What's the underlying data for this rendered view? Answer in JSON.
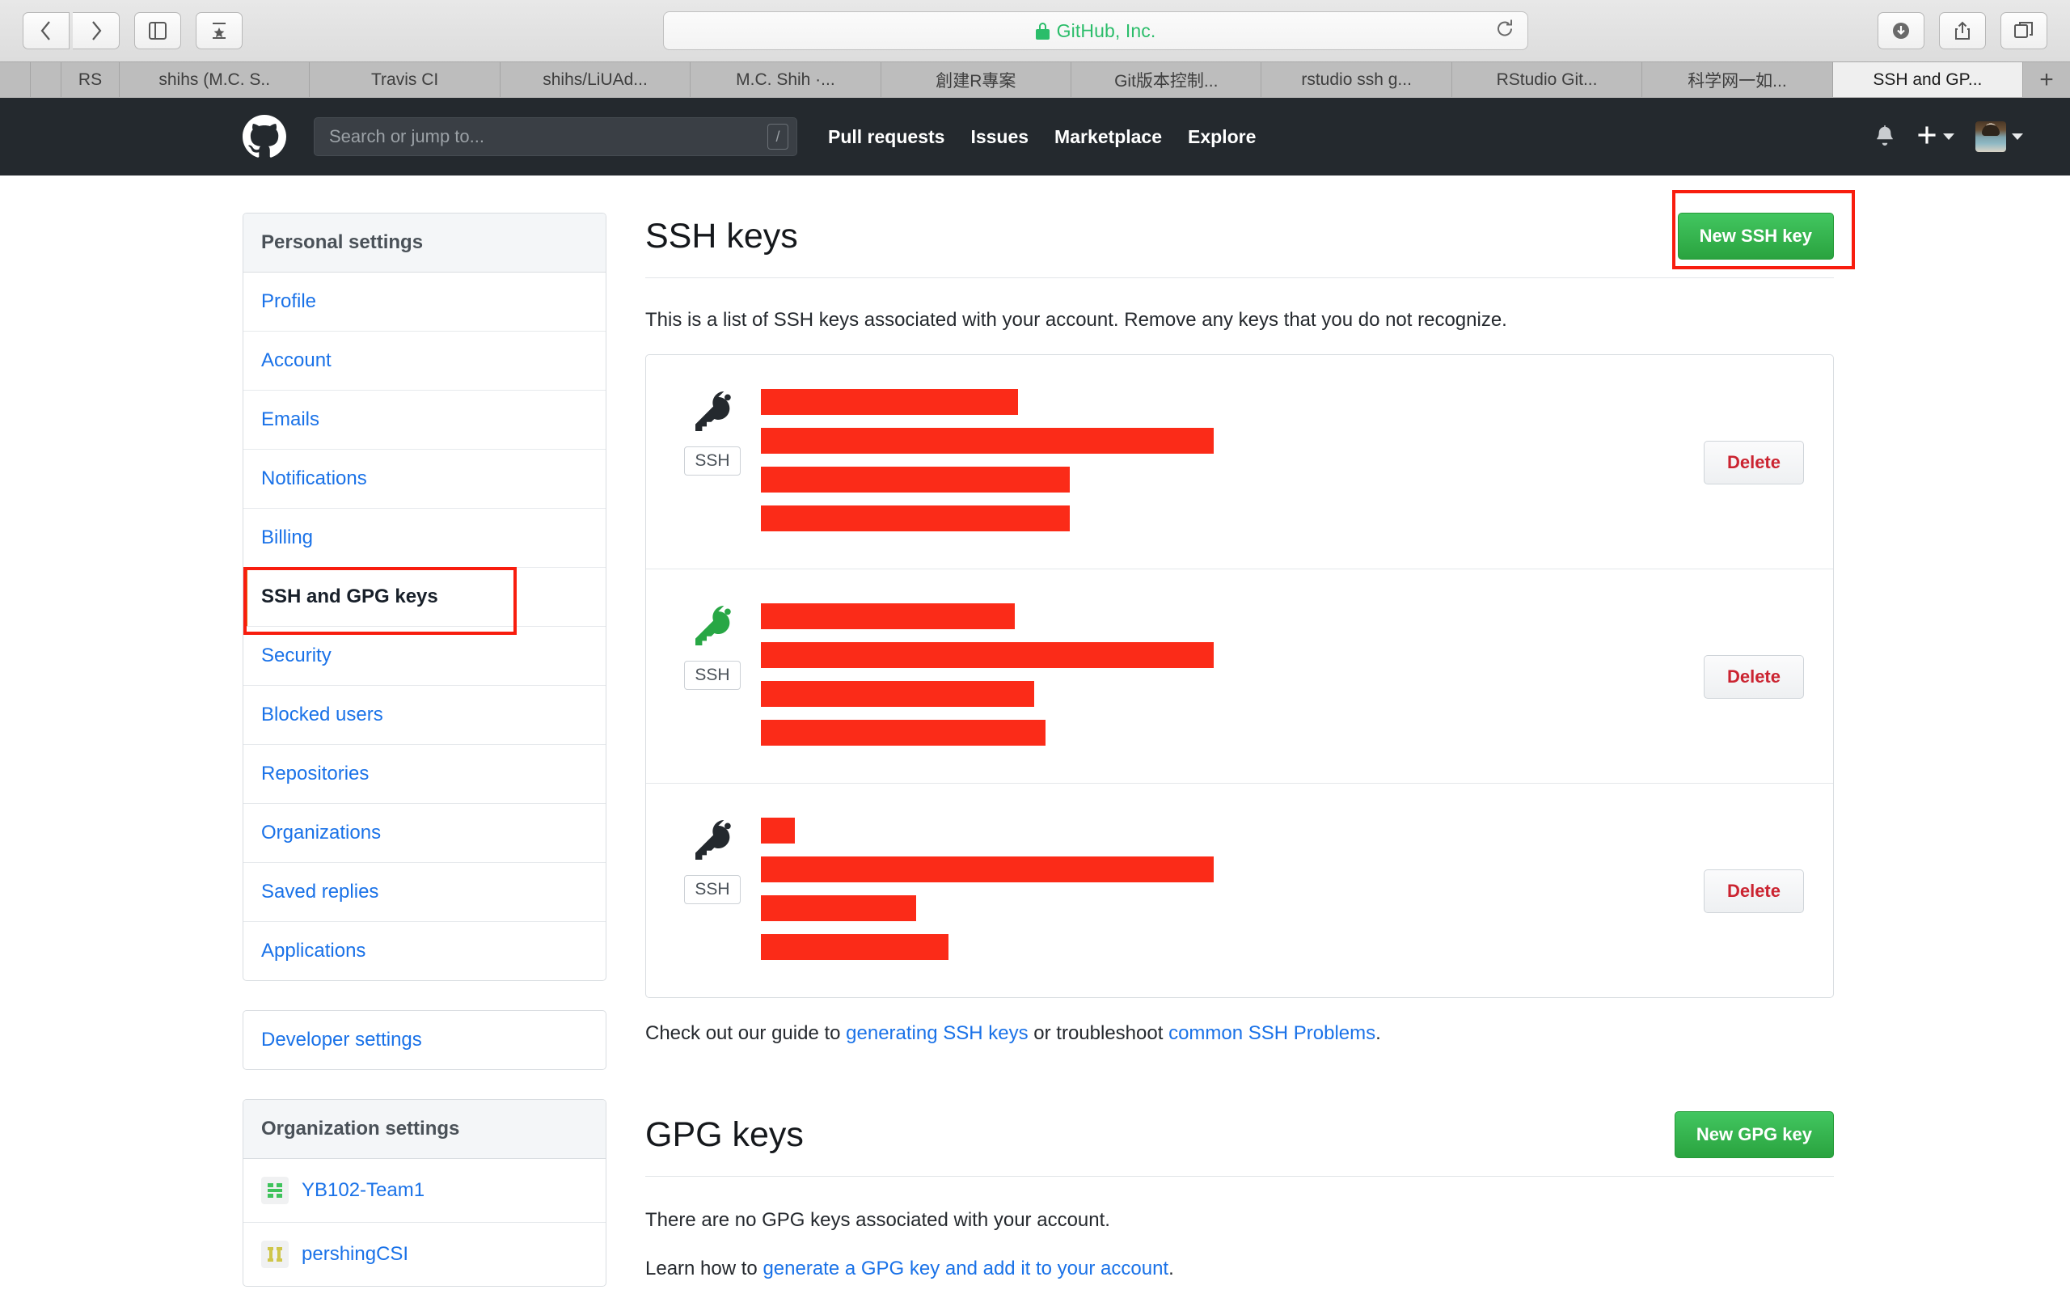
{
  "browser": {
    "address": {
      "site_name": "GitHub, Inc.",
      "secure_icon": "lock-icon",
      "reload_icon": "reload-icon"
    },
    "nav_back_icon": "chevron-left-icon",
    "nav_forward_icon": "chevron-right-icon",
    "sidebar_toggle_icon": "sidebar-icon",
    "bookmarks_icon": "bookmarks-icon",
    "downloads_icon": "downloads-icon",
    "share_icon": "share-icon",
    "tabs_overview_icon": "tabs-overview-icon",
    "new_tab_label": "+",
    "tabs": [
      {
        "label": "",
        "size": "tiny"
      },
      {
        "label": "",
        "size": "tiny"
      },
      {
        "label": "RS",
        "size": "narrow"
      },
      {
        "label": "shihs (M.C. S..",
        "size": "normal"
      },
      {
        "label": "Travis CI",
        "size": "normal"
      },
      {
        "label": "shihs/LiUAd...",
        "size": "normal"
      },
      {
        "label": "M.C. Shih ·...",
        "size": "normal"
      },
      {
        "label": "創建R專案",
        "size": "normal"
      },
      {
        "label": "Git版本控制...",
        "size": "normal"
      },
      {
        "label": "rstudio ssh g...",
        "size": "normal"
      },
      {
        "label": "RStudio Git...",
        "size": "normal"
      },
      {
        "label": "科学网一如...",
        "size": "normal"
      },
      {
        "label": "SSH and GP...",
        "size": "normal",
        "active": true
      }
    ]
  },
  "github_header": {
    "logo_icon": "github-mark-icon",
    "search_placeholder": "Search or jump to...",
    "search_value": "",
    "search_shortcut": "/",
    "nav": [
      {
        "label": "Pull requests"
      },
      {
        "label": "Issues"
      },
      {
        "label": "Marketplace"
      },
      {
        "label": "Explore"
      }
    ],
    "notifications_icon": "bell-icon",
    "create_new_icon": "plus-icon",
    "avatar_icon": "avatar"
  },
  "sidebar": {
    "personal": {
      "heading": "Personal settings",
      "items": [
        {
          "label": "Profile"
        },
        {
          "label": "Account"
        },
        {
          "label": "Emails"
        },
        {
          "label": "Notifications"
        },
        {
          "label": "Billing"
        },
        {
          "label": "SSH and GPG keys",
          "selected": true,
          "highlighted": true
        },
        {
          "label": "Security"
        },
        {
          "label": "Blocked users"
        },
        {
          "label": "Repositories"
        },
        {
          "label": "Organizations"
        },
        {
          "label": "Saved replies"
        },
        {
          "label": "Applications"
        }
      ]
    },
    "developer": {
      "label": "Developer settings"
    },
    "organizations": {
      "heading": "Organization settings",
      "items": [
        {
          "label": "YB102-Team1",
          "icon": "org-avatar-green"
        },
        {
          "label": "pershingCSI",
          "icon": "org-avatar-yellow"
        }
      ]
    }
  },
  "main": {
    "ssh": {
      "title": "SSH keys",
      "new_key_button": "New SSH key",
      "new_key_button_highlighted": true,
      "description": "This is a list of SSH keys associated with your account. Remove any keys that you do not recognize.",
      "delete_label": "Delete",
      "ssh_badge": "SSH",
      "keys": [
        {
          "key_icon": "key-icon",
          "key_icon_color": "#24292e",
          "lines": [
            {
              "text": "",
              "bold": true,
              "redacted": true,
              "redact_width": 318,
              "redact_offset": 0
            },
            {
              "text": "",
              "redacted": true,
              "redact_width": 560,
              "redact_offset": 0
            },
            {
              "text": "",
              "redacted": true,
              "redact_width": 382,
              "redact_offset": 0
            },
            {
              "text": "",
              "redacted": true,
              "redact_width": 382,
              "redact_offset": 0
            }
          ]
        },
        {
          "key_icon": "key-icon",
          "key_icon_color": "#28a745",
          "lines": [
            {
              "text": "",
              "bold": true,
              "redacted": true,
              "redact_width": 314,
              "redact_offset": 0
            },
            {
              "text": "",
              "redacted": true,
              "redact_width": 560,
              "redact_offset": 0
            },
            {
              "text": "",
              "redacted": true,
              "redact_width": 338,
              "redact_offset": 0
            },
            {
              "text": "",
              "redacted": true,
              "redact_width": 352,
              "redact_offset": 0
            }
          ]
        },
        {
          "key_icon": "key-icon",
          "key_icon_color": "#24292e",
          "lines": [
            {
              "text": "",
              "bold": true,
              "redacted": true,
              "redact_width": 42,
              "redact_offset": 0
            },
            {
              "text": "",
              "redacted": true,
              "redact_width": 560,
              "redact_offset": 0
            },
            {
              "text": "",
              "redacted": true,
              "redact_width": 192,
              "redact_offset": 0
            },
            {
              "text": "",
              "redacted": true,
              "redact_width": 232,
              "redact_offset": 0
            }
          ]
        }
      ],
      "footnote": {
        "prefix": "Check out our guide to ",
        "link1": "generating SSH keys",
        "middle": " or troubleshoot ",
        "link2": "common SSH Problems",
        "suffix": "."
      }
    },
    "gpg": {
      "title": "GPG keys",
      "new_key_button": "New GPG key",
      "empty_message": "There are no GPG keys associated with your account.",
      "learn_prefix": "Learn how to ",
      "learn_link": "generate a GPG key and add it to your account",
      "learn_suffix": "."
    }
  },
  "colors": {
    "github_dark": "#24292e",
    "link_blue": "#1a72e8",
    "green_button": "#2aa33f",
    "delete_red": "#cb2431",
    "highlight_red": "#f81d0e",
    "redaction_red": "#fb2b18",
    "selected_orange": "#e36209"
  }
}
